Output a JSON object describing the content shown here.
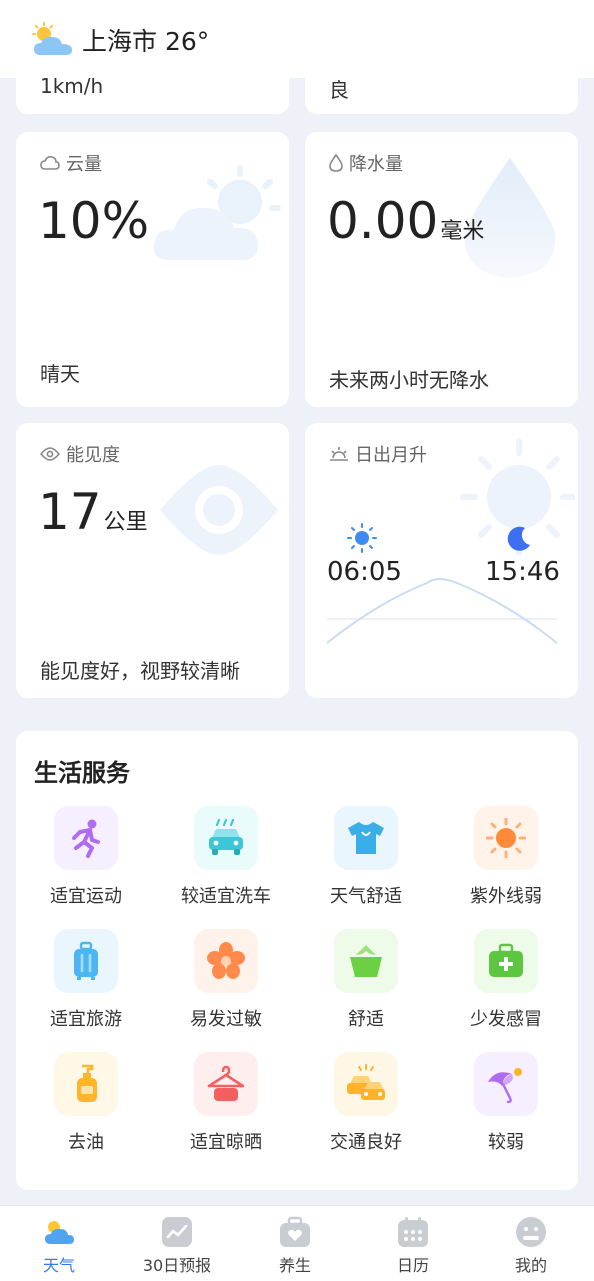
{
  "header": {
    "title": "上海市 26°"
  },
  "top_partial": {
    "left_text": "1km/h",
    "right_text": "良"
  },
  "cards": {
    "cloud": {
      "label": "云量",
      "value": "10%",
      "unit": "",
      "desc": "晴天"
    },
    "rain": {
      "label": "降水量",
      "value": "0.00",
      "unit": "毫米",
      "desc": "未来两小时无降水"
    },
    "visibility": {
      "label": "能见度",
      "value": "17",
      "unit": "公里",
      "desc": "能见度好，视野较清晰"
    },
    "sun": {
      "label": "日出月升",
      "sunrise": "06:05",
      "moonrise": "15:46"
    }
  },
  "services": {
    "title": "生活服务",
    "items": [
      {
        "label": "适宜运动",
        "icon": "running-icon",
        "bg": "#f6efff",
        "color": "#b06cf0"
      },
      {
        "label": "较适宜洗车",
        "icon": "car-wash-icon",
        "bg": "#eafbfb",
        "color": "#3cc6d6"
      },
      {
        "label": "天气舒适",
        "icon": "tshirt-icon",
        "bg": "#eaf6fd",
        "color": "#3aaee8"
      },
      {
        "label": "紫外线弱",
        "icon": "sun-uv-icon",
        "bg": "#fff3ea",
        "color": "#ff8a3a"
      },
      {
        "label": "适宜旅游",
        "icon": "luggage-icon",
        "bg": "#eaf6fd",
        "color": "#4cb6f2"
      },
      {
        "label": "易发过敏",
        "icon": "flower-icon",
        "bg": "#fff2ea",
        "color": "#ff8a4c"
      },
      {
        "label": "舒适",
        "icon": "plant-pot-icon",
        "bg": "#eefbe8",
        "color": "#6bd044"
      },
      {
        "label": "少发感冒",
        "icon": "medical-kit-icon",
        "bg": "#eefbe8",
        "color": "#5cc640"
      },
      {
        "label": "去油",
        "icon": "lotion-bottle-icon",
        "bg": "#fff8e6",
        "color": "#ffb52a"
      },
      {
        "label": "适宜晾晒",
        "icon": "hanger-icon",
        "bg": "#ffeeee",
        "color": "#f2615f"
      },
      {
        "label": "交通良好",
        "icon": "traffic-cars-icon",
        "bg": "#fff7e6",
        "color": "#ffb22a"
      },
      {
        "label": "较弱",
        "icon": "umbrella-icon",
        "bg": "#f6efff",
        "color": "#b06cf0"
      }
    ]
  },
  "tabbar": {
    "active_color": "#2f7bf5",
    "items": [
      {
        "label": "天气",
        "icon": "weather-icon",
        "active": true
      },
      {
        "label": "30日预报",
        "icon": "forecast-chart-icon",
        "active": false
      },
      {
        "label": "养生",
        "icon": "health-bag-icon",
        "active": false
      },
      {
        "label": "日历",
        "icon": "calendar-icon",
        "active": false
      },
      {
        "label": "我的",
        "icon": "profile-icon",
        "active": false
      }
    ]
  }
}
